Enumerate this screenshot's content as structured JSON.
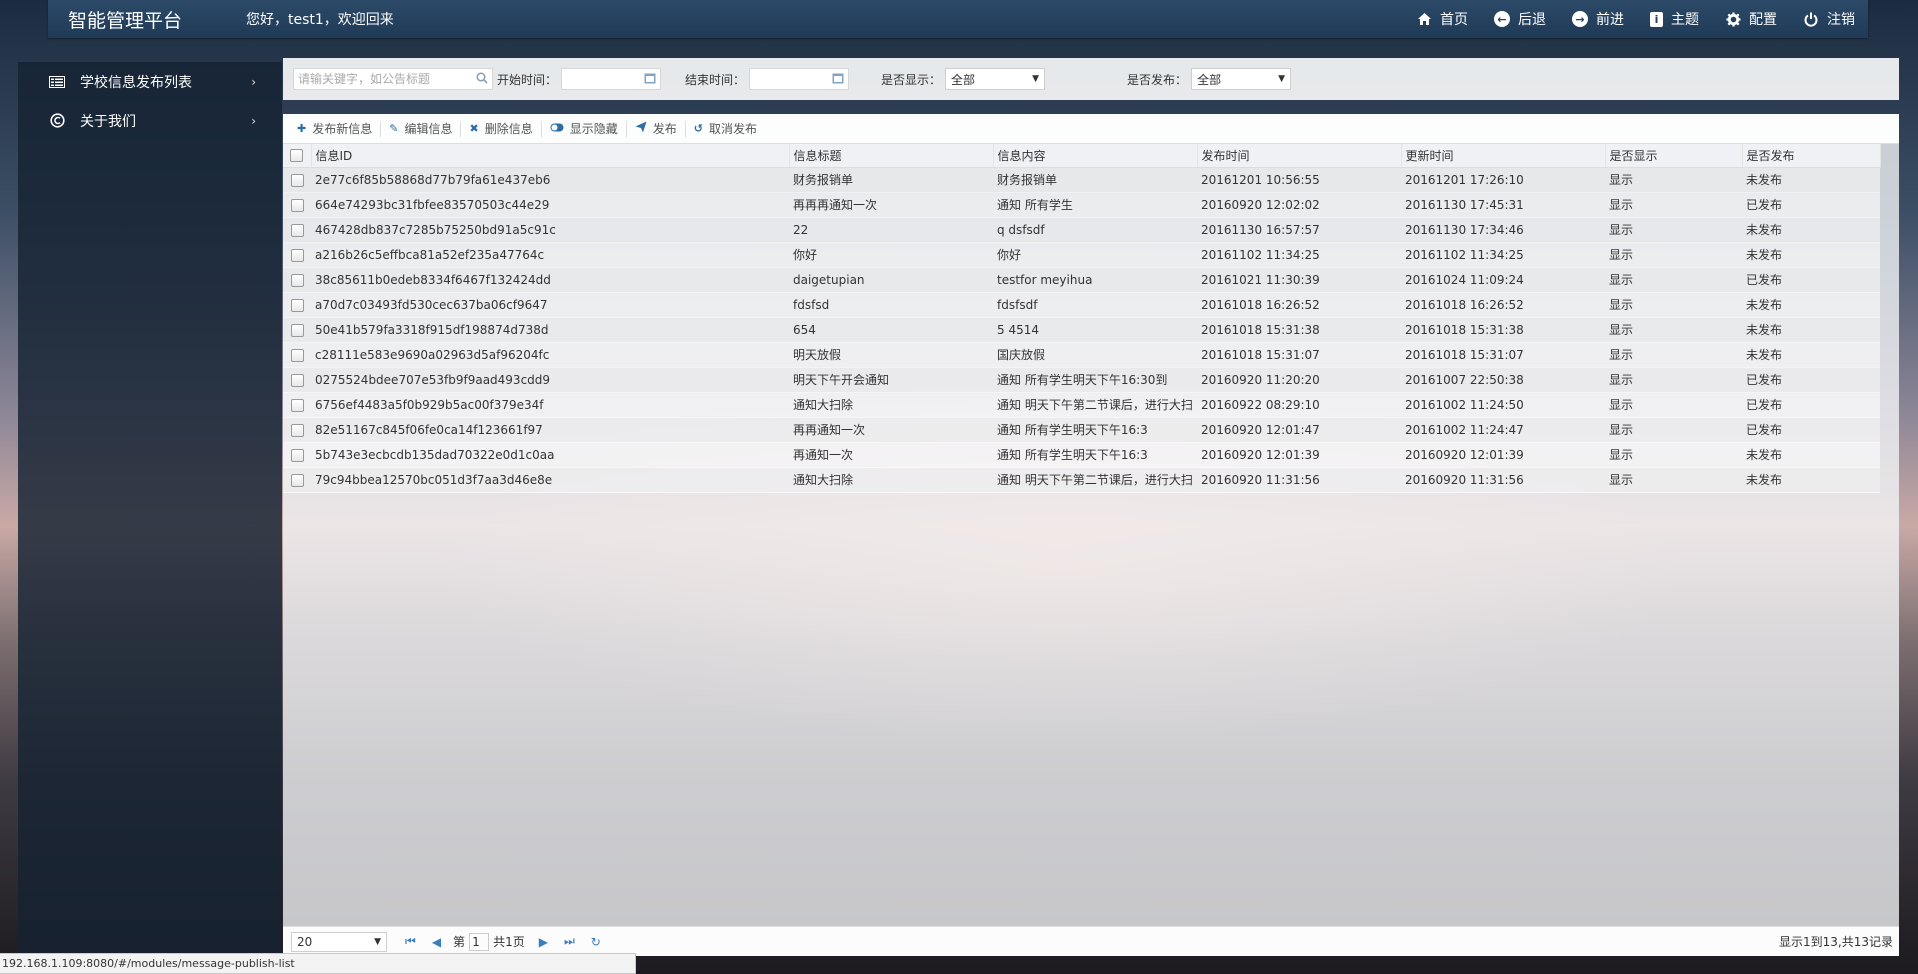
{
  "header": {
    "brand": "智能管理平台",
    "welcome": "您好，test1，欢迎回来",
    "nav": [
      {
        "label": "首页",
        "icon": "home-icon"
      },
      {
        "label": "后退",
        "icon": "back-icon"
      },
      {
        "label": "前进",
        "icon": "forward-icon"
      },
      {
        "label": "主题",
        "icon": "theme-icon"
      },
      {
        "label": "配置",
        "icon": "gear-icon"
      },
      {
        "label": "注销",
        "icon": "power-icon"
      }
    ]
  },
  "sidebar": {
    "items": [
      {
        "label": "学校信息发布列表",
        "icon": "list-icon"
      },
      {
        "label": "关于我们",
        "icon": "copyright-icon"
      }
    ]
  },
  "search": {
    "keyword_placeholder": "请输关键字，如公告标题",
    "start_label": "开始时间：",
    "end_label": "结束时间：",
    "show_label": "是否显示：",
    "show_value": "全部",
    "publish_label": "是否发布：",
    "publish_value": "全部"
  },
  "toolbar": {
    "add": "发布新信息",
    "edit": "编辑信息",
    "delete": "删除信息",
    "toggle": "显示隐藏",
    "publish": "发布",
    "unpublish": "取消发布"
  },
  "table": {
    "columns": [
      "信息ID",
      "信息标题",
      "信息内容",
      "发布时间",
      "更新时间",
      "是否显示",
      "是否发布"
    ],
    "rows": [
      [
        "2e77c6f85b58868d77b79fa61e437eb6",
        "财务报销单",
        "财务报销单",
        "20161201 10:56:55",
        "20161201 17:26:10",
        "显示",
        "未发布"
      ],
      [
        "664e74293bc31fbfee83570503c44e29",
        "再再再通知一次",
        "通知 所有学生",
        "20160920 12:02:02",
        "20161130 17:45:31",
        "显示",
        "已发布"
      ],
      [
        "467428db837c7285b75250bd91a5c91c",
        "22",
        "q dsfsdf",
        "20161130 16:57:57",
        "20161130 17:34:46",
        "显示",
        "未发布"
      ],
      [
        "a216b26c5effbca81a52ef235a47764c",
        "你好",
        "你好",
        "20161102 11:34:25",
        "20161102 11:34:25",
        "显示",
        "未发布"
      ],
      [
        "38c85611b0edeb8334f6467f132424dd",
        "daigetupian",
        "testfor meyihua",
        "20161021 11:30:39",
        "20161024 11:09:24",
        "显示",
        "已发布"
      ],
      [
        "a70d7c03493fd530cec637ba06cf9647",
        "fdsfsd",
        "fdsfsdf",
        "20161018 16:26:52",
        "20161018 16:26:52",
        "显示",
        "未发布"
      ],
      [
        "50e41b579fa3318f915df198874d738d",
        "654",
        "5 4514",
        "20161018 15:31:38",
        "20161018 15:31:38",
        "显示",
        "未发布"
      ],
      [
        "c28111e583e9690a02963d5af96204fc",
        "明天放假",
        "国庆放假",
        "20161018 15:31:07",
        "20161018 15:31:07",
        "显示",
        "未发布"
      ],
      [
        "0275524bdee707e53fb9f9aad493cdd9",
        "明天下午开会通知",
        "通知 所有学生明天下午16:30到",
        "20160920 11:20:20",
        "20161007 22:50:38",
        "显示",
        "已发布"
      ],
      [
        "6756ef4483a5f0b929b5ac00f379e34f",
        "通知大扫除",
        "通知 明天下午第二节课后，进行大扫",
        "20160922 08:29:10",
        "20161002 11:24:50",
        "显示",
        "已发布"
      ],
      [
        "82e51167c845f06fe0ca14f123661f97",
        "再再通知一次",
        "通知 所有学生明天下午16:3",
        "20160920 12:01:47",
        "20161002 11:24:47",
        "显示",
        "已发布"
      ],
      [
        "5b743e3ecbcdb135dad70322e0d1c0aa",
        "再通知一次",
        "通知 所有学生明天下午16:3",
        "20160920 12:01:39",
        "20160920 12:01:39",
        "显示",
        "未发布"
      ],
      [
        "79c94bbea12570bc051d3f7aa3d46e8e",
        "通知大扫除",
        "通知 明天下午第二节课后，进行大扫",
        "20160920 11:31:56",
        "20160920 11:31:56",
        "显示",
        "未发布"
      ]
    ]
  },
  "pager": {
    "page_size": "20",
    "page_prefix": "第",
    "page_number": "1",
    "page_total": "共1页",
    "info": "显示1到13,共13记录"
  },
  "statusbar": {
    "url": "192.168.1.109:8080/#/modules/message-publish-list"
  }
}
